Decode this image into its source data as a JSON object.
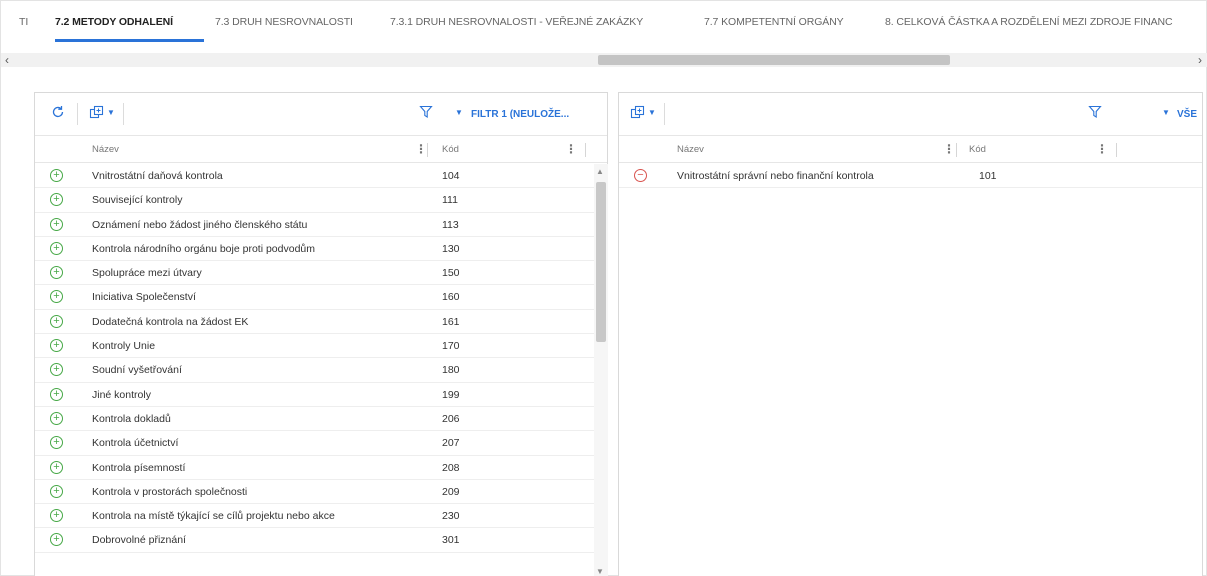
{
  "tabs": [
    {
      "label": "TI",
      "active": false
    },
    {
      "label": "7.2 METODY ODHALENÍ",
      "active": true
    },
    {
      "label": "7.3 DRUH NESROVNALOSTI",
      "active": false
    },
    {
      "label": "7.3.1 DRUH NESROVNALOSTI - VEŘEJNÉ ZAKÁZKY",
      "active": false
    },
    {
      "label": "7.7 KOMPETENTNÍ ORGÁNY",
      "active": false
    },
    {
      "label": "8. CELKOVÁ ČÁSTKA A ROZDĚLENÍ MEZI ZDROJE FINANC",
      "active": false
    }
  ],
  "hscroll": {
    "left_arrow": "‹",
    "right_arrow": "›"
  },
  "left_panel": {
    "filter_label": "FILTR 1 (NEULOŽE...",
    "columns": {
      "name": "Název",
      "code": "Kód"
    },
    "rows": [
      {
        "name": "Vnitrostátní daňová kontrola",
        "code": "104"
      },
      {
        "name": "Související kontroly",
        "code": "111"
      },
      {
        "name": "Oznámení nebo žádost jiného členského státu",
        "code": "113"
      },
      {
        "name": "Kontrola národního orgánu boje proti podvodům",
        "code": "130"
      },
      {
        "name": "Spolupráce mezi útvary",
        "code": "150"
      },
      {
        "name": "Iniciativa Společenství",
        "code": "160"
      },
      {
        "name": "Dodatečná kontrola na žádost EK",
        "code": "161"
      },
      {
        "name": "Kontroly Unie",
        "code": "170"
      },
      {
        "name": "Soudní vyšetřování",
        "code": "180"
      },
      {
        "name": "Jiné kontroly",
        "code": "199"
      },
      {
        "name": "Kontrola dokladů",
        "code": "206"
      },
      {
        "name": "Kontrola účetnictví",
        "code": "207"
      },
      {
        "name": "Kontrola písemností",
        "code": "208"
      },
      {
        "name": "Kontrola v prostorách společnosti",
        "code": "209"
      },
      {
        "name": "Kontrola na místě týkající se cílů projektu nebo akce",
        "code": "230"
      },
      {
        "name": "Dobrovolné přiznání",
        "code": "301"
      }
    ]
  },
  "right_panel": {
    "filter_label": "VŠE",
    "columns": {
      "name": "Název",
      "code": "Kód"
    },
    "rows": [
      {
        "name": "Vnitrostátní správní nebo finanční kontrola",
        "code": "101"
      }
    ]
  },
  "icons": {
    "refresh": "refresh-icon",
    "export": "export-icon",
    "filter": "filter-icon",
    "add": "add-circle-icon",
    "remove": "remove-circle-icon"
  },
  "colors": {
    "accent": "#2a73d8",
    "add": "#47a847",
    "remove": "#d9534f"
  }
}
